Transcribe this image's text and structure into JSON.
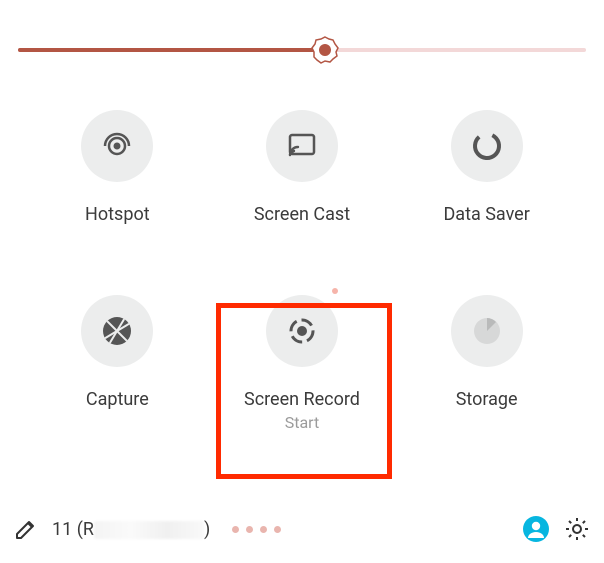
{
  "slider": {
    "value_pct": 54
  },
  "tiles": [
    {
      "id": "hotspot",
      "label": "Hotspot",
      "sublabel": "",
      "icon": "hotspot-icon"
    },
    {
      "id": "screencast",
      "label": "Screen Cast",
      "sublabel": "",
      "icon": "cast-icon"
    },
    {
      "id": "datasaver",
      "label": "Data Saver",
      "sublabel": "",
      "icon": "data-saver-icon"
    },
    {
      "id": "capture",
      "label": "Capture",
      "sublabel": "",
      "icon": "aperture-icon"
    },
    {
      "id": "screenrecord",
      "label": "Screen Record",
      "sublabel": "Start",
      "icon": "record-icon",
      "highlighted": true
    },
    {
      "id": "storage",
      "label": "Storage",
      "sublabel": "",
      "icon": "storage-pie-icon"
    }
  ],
  "footer": {
    "build_prefix": "11 (R",
    "build_suffix": ")",
    "pager_count": 4,
    "user_color": "#07b6e0"
  },
  "colors": {
    "slider_fill": "#b35644",
    "slider_track": "#f3d8d8",
    "highlight": "#ff2a00"
  }
}
